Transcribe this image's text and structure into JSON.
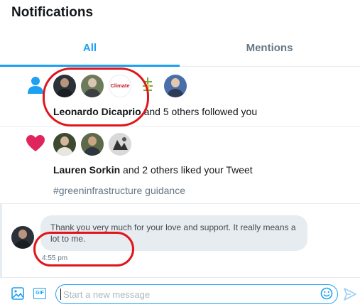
{
  "header": {
    "title": "Notifications"
  },
  "tabs": [
    {
      "label": "All",
      "active": true
    },
    {
      "label": "Mentions",
      "active": false
    }
  ],
  "notifications": [
    {
      "type": "follow",
      "icon": "person-icon",
      "actor": "Leonardo Dicaprio",
      "text": " and 5 others followed you",
      "avatar_labels": [
        "Climate"
      ]
    },
    {
      "type": "like",
      "icon": "heart-icon",
      "actor": "Lauren Sorkin",
      "text": " and 2 others liked your Tweet",
      "tweet_text": "#greeninfrastructure guidance"
    }
  ],
  "message": {
    "text": "Thank you very much for your love and support. It really means a lot to me.",
    "time": "4:55 pm"
  },
  "composer": {
    "placeholder": "Start a new message",
    "gif_label": "GIF"
  },
  "colors": {
    "accent": "#1da1f2",
    "heart": "#e0245e",
    "annotation": "#e0151b",
    "bubble": "#e6ecf0"
  }
}
